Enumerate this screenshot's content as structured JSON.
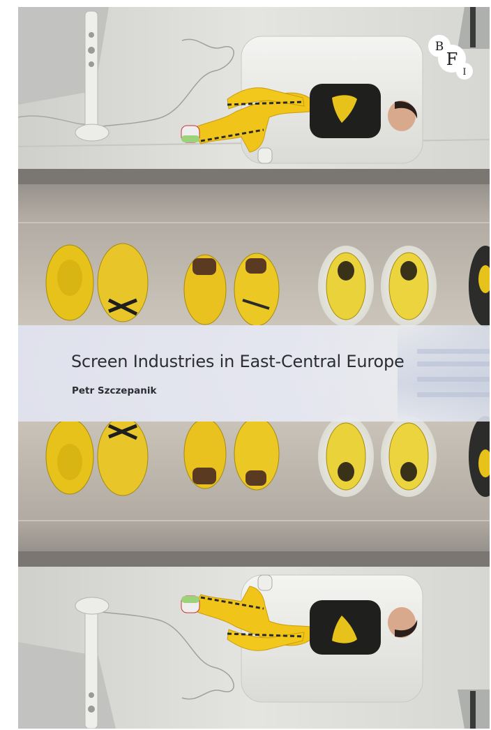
{
  "book": {
    "title": "Screen Industries in East-Central Europe",
    "author": "Petr Szczepanik"
  },
  "publisher_logo": {
    "letters": [
      "B",
      "F",
      "I"
    ],
    "icon": "bfi-logo"
  },
  "colors": {
    "title_text": "#2b2d33",
    "band": "#e2e4ee",
    "sneaker_yellow": "#e6c21a",
    "tracksuit_yellow": "#f0c419"
  }
}
